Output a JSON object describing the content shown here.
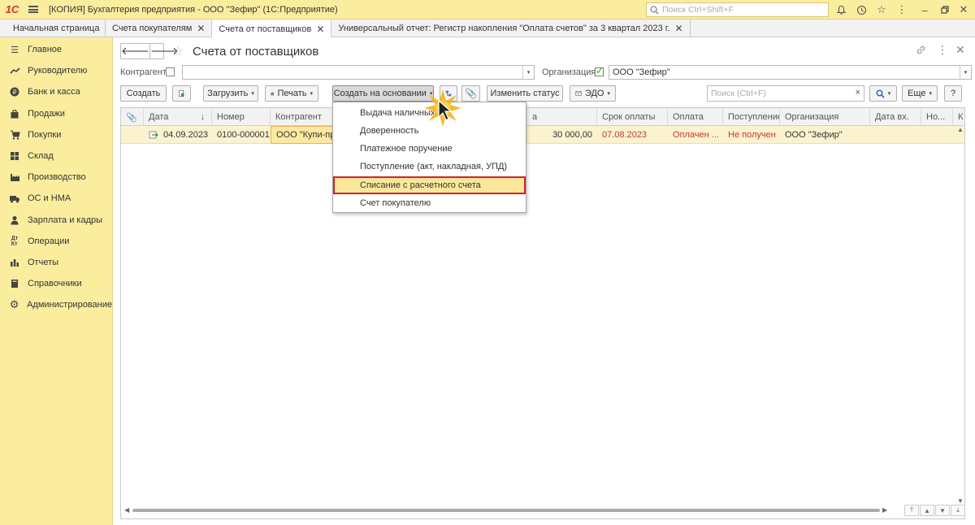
{
  "titlebar": {
    "logo": "1С",
    "title": "[КОПИЯ] Бухгалтерия предприятия - ООО \"Зефир\"  (1С:Предприятие)",
    "search_placeholder": "Поиск Ctrl+Shift+F"
  },
  "tabs": [
    {
      "label": "Начальная страница",
      "closable": false
    },
    {
      "label": "Счета покупателям",
      "closable": true
    },
    {
      "label": "Счета от поставщиков",
      "closable": true,
      "active": true
    },
    {
      "label": "Универсальный отчет: Регистр накопления \"Оплата счетов\" за 3 квартал 2023 г.",
      "closable": true
    }
  ],
  "sidebar": {
    "items": [
      {
        "label": "Главное",
        "icon": "menu-icon"
      },
      {
        "label": "Руководителю",
        "icon": "trend-icon"
      },
      {
        "label": "Банк и касса",
        "icon": "ruble-icon"
      },
      {
        "label": "Продажи",
        "icon": "bag-icon"
      },
      {
        "label": "Покупки",
        "icon": "cart-icon"
      },
      {
        "label": "Склад",
        "icon": "warehouse-icon"
      },
      {
        "label": "Производство",
        "icon": "factory-icon"
      },
      {
        "label": "ОС и НМА",
        "icon": "truck-icon"
      },
      {
        "label": "Зарплата и кадры",
        "icon": "person-icon"
      },
      {
        "label": "Операции",
        "icon": "dtkt-icon"
      },
      {
        "label": "Отчеты",
        "icon": "bars-icon"
      },
      {
        "label": "Справочники",
        "icon": "books-icon"
      },
      {
        "label": "Администрирование",
        "icon": "gear-icon"
      }
    ]
  },
  "page": {
    "title": "Счета от поставщиков"
  },
  "filters": {
    "counterparty_label": "Контрагент:",
    "counterparty_value": "",
    "org_label": "Организация:",
    "org_value": "ООО \"Зефир\""
  },
  "toolbar": {
    "create": "Создать",
    "load": "Загрузить",
    "print": "Печать",
    "create_based": "Создать на основании",
    "change_status": "Изменить статус",
    "edo": "ЭДО",
    "search_placeholder": "Поиск (Ctrl+F)",
    "more": "Еще",
    "help": "?"
  },
  "table": {
    "columns": [
      "Дата",
      "Номер",
      "Контрагент",
      "",
      "а",
      "Срок оплаты",
      "Оплата",
      "Поступление",
      "Организация",
      "Дата вх.",
      "Но...",
      "К"
    ],
    "row": {
      "date": "04.09.2023",
      "number": "0100-000001",
      "counterparty": "ООО \"Купи-прод",
      "amount": "30 000,00",
      "due": "07.08.2023",
      "payment": "Оплачен ...",
      "receipt": "Не получен",
      "org": "ООО \"Зефир\""
    }
  },
  "dropdown": {
    "items": [
      {
        "label": "Выдача наличных"
      },
      {
        "label": "Доверенность"
      },
      {
        "label": "Платежное поручение"
      },
      {
        "label": "Поступление (акт, накладная, УПД)"
      },
      {
        "label": "Списание с расчетного счета",
        "highlighted": true
      },
      {
        "label": "Счет покупателю"
      }
    ]
  },
  "colors": {
    "accent_yellow": "#fbed9e",
    "highlight_red": "#d3202b",
    "overdue_red": "#c0392b"
  }
}
